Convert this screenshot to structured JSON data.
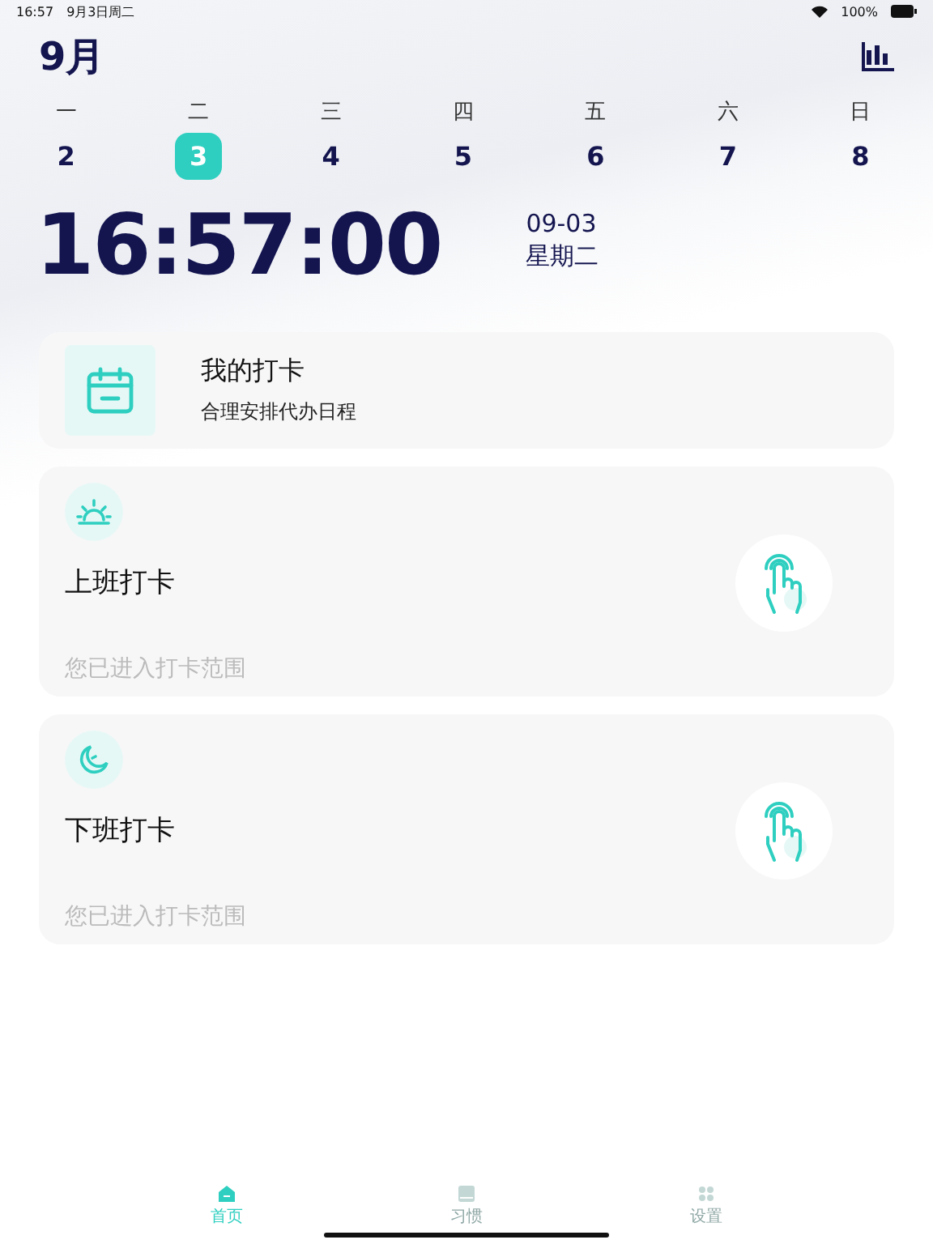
{
  "status_bar": {
    "time": "16:57",
    "date": "9月3日周二",
    "battery": "100%"
  },
  "header": {
    "month": "9月"
  },
  "week": [
    {
      "weekday": "一",
      "date": "2",
      "selected": false
    },
    {
      "weekday": "二",
      "date": "3",
      "selected": true
    },
    {
      "weekday": "三",
      "date": "4",
      "selected": false
    },
    {
      "weekday": "四",
      "date": "5",
      "selected": false
    },
    {
      "weekday": "五",
      "date": "6",
      "selected": false
    },
    {
      "weekday": "六",
      "date": "7",
      "selected": false
    },
    {
      "weekday": "日",
      "date": "8",
      "selected": false
    }
  ],
  "clock": {
    "time": "16:57:00",
    "date": "09-03",
    "weekday": "星期二"
  },
  "summary_card": {
    "title": "我的打卡",
    "subtitle": "合理安排代办日程"
  },
  "punch_cards": [
    {
      "kind": "sunrise",
      "title": "上班打卡",
      "status": "您已进入打卡范围"
    },
    {
      "kind": "moon",
      "title": "下班打卡",
      "status": "您已进入打卡范围"
    }
  ],
  "tab_bar": [
    {
      "kind": "home",
      "label": "首页",
      "selected": true
    },
    {
      "kind": "book",
      "label": "习惯",
      "selected": false
    },
    {
      "kind": "grid",
      "label": "设置",
      "selected": false
    }
  ]
}
